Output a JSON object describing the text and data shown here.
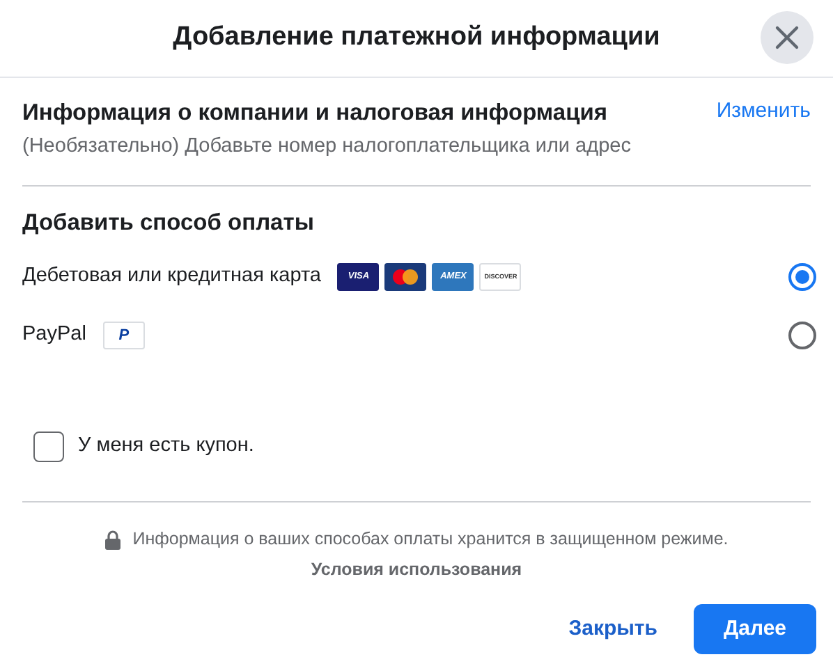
{
  "dialog": {
    "title": "Добавление платежной информации"
  },
  "company_section": {
    "title": "Информация о компании и налоговая информация",
    "subtitle": "(Необязательно) Добавьте номер налогоплательщика или адрес",
    "edit_link": "Изменить"
  },
  "payment_section": {
    "title": "Добавить способ оплаты"
  },
  "payment_methods": [
    {
      "label": "Дебетовая или кредитная карта",
      "selected": true,
      "logos": [
        {
          "kind": "visa",
          "label": "VISA"
        },
        {
          "kind": "mastercard"
        },
        {
          "kind": "amex",
          "label": "AMEX"
        },
        {
          "kind": "discover",
          "label": "DISCOVER"
        }
      ]
    },
    {
      "label": "PayPal",
      "selected": false,
      "logos": [
        {
          "kind": "paypal",
          "label": "P"
        }
      ]
    }
  ],
  "coupon": {
    "label": "У меня есть купон.",
    "checked": false
  },
  "security_note": "Информация о ваших способах оплаты хранится в защищенном режиме.",
  "terms_link": "Условия использования",
  "buttons": [
    {
      "kind": "link",
      "label": "Закрыть"
    },
    {
      "kind": "primary",
      "label": "Далее"
    }
  ]
}
